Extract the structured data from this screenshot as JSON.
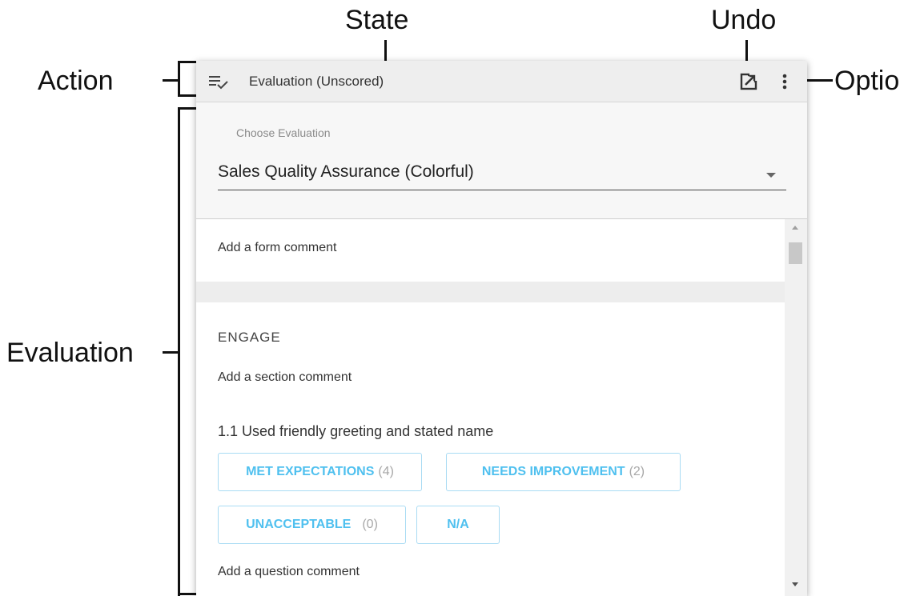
{
  "callouts": {
    "action": "Action",
    "state": "State",
    "undo": "Undo",
    "options": "Optio",
    "evaluation": "Evaluation"
  },
  "titlebar": {
    "action_icon": "playlist-check-icon",
    "state_text": "Evaluation (Unscored)",
    "undo_icon": "open-in-new-icon",
    "options_icon": "more-vert-icon"
  },
  "chooser": {
    "label": "Choose Evaluation",
    "selected": "Sales Quality Assurance (Colorful)",
    "caret_icon": "dropdown-caret-icon"
  },
  "form": {
    "form_comment": "Add a form comment",
    "section": {
      "title": "ENGAGE",
      "comment": "Add a section comment",
      "question": {
        "text": "1.1 Used friendly greeting and stated name",
        "answers": [
          {
            "label": "MET EXPECTATIONS",
            "count": "(4)"
          },
          {
            "label": "NEEDS IMPROVEMENT",
            "count": "(2)"
          },
          {
            "label": "UNACCEPTABLE",
            "count": "(0)"
          },
          {
            "label": "N/A",
            "count": ""
          }
        ],
        "comment": "Add a question comment"
      }
    }
  },
  "colors": {
    "accent": "#4fc0ef",
    "chip_border": "#a9dbf3",
    "titlebar_bg": "#eeeeee",
    "chooser_bg": "#f7f7f7"
  }
}
